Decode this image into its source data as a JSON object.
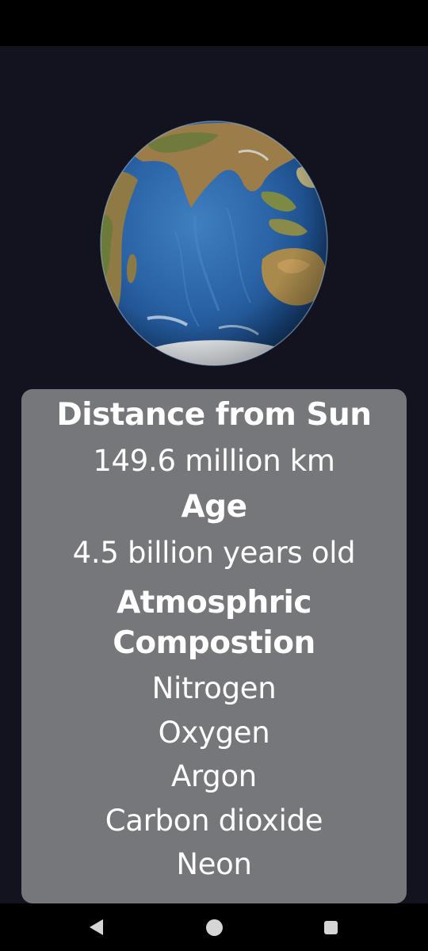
{
  "planet": {
    "image_icon": "earth-globe-image"
  },
  "info": {
    "distance": {
      "heading": "Distance from Sun",
      "value": "149.6 million km"
    },
    "age": {
      "heading": "Age",
      "value": "4.5 billion years old"
    },
    "atmosphere": {
      "heading": "Atmosphric Compostion",
      "gases": [
        "Nitrogen",
        "Oxygen",
        "Argon",
        "Carbon dioxide",
        "Neon"
      ]
    }
  },
  "nav": {
    "back_icon": "back-triangle-icon",
    "home_icon": "home-circle-icon",
    "recents_icon": "recents-square-icon"
  },
  "colors": {
    "background": "#13131f",
    "card": "#76777b",
    "text": "#ffffff",
    "system_bars": "#000000"
  }
}
